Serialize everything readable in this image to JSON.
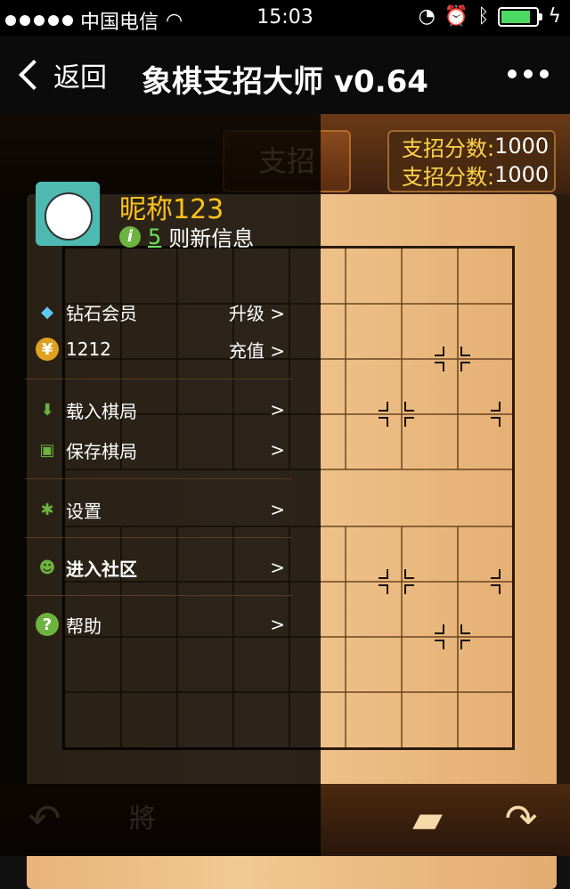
{
  "status": {
    "carrier": "中国电信",
    "time": "15:03"
  },
  "nav": {
    "back_label": "返回",
    "title": "象棋支招大师 v0.64"
  },
  "scores": [
    {
      "label": "支招分数:",
      "value": "1000"
    },
    {
      "label": "支招分数:",
      "value": "1000"
    }
  ],
  "support_button": "支招",
  "profile": {
    "nickname": "昵称123",
    "unread_count": "5",
    "unread_text": "则新信息"
  },
  "menu": [
    {
      "label": "钻石会员",
      "action": "升级 >"
    },
    {
      "label": "1212",
      "action": "充值 >"
    },
    {
      "label": "载入棋局",
      "action": ">"
    },
    {
      "label": "保存棋局",
      "action": ">"
    },
    {
      "label": "设置",
      "action": ">"
    },
    {
      "label": "进入社区",
      "action": ">"
    },
    {
      "label": "帮助",
      "action": ">"
    }
  ],
  "colors": {
    "accent": "#ffc21a",
    "board": "#f0c48c",
    "menu_bg": "#000000"
  }
}
